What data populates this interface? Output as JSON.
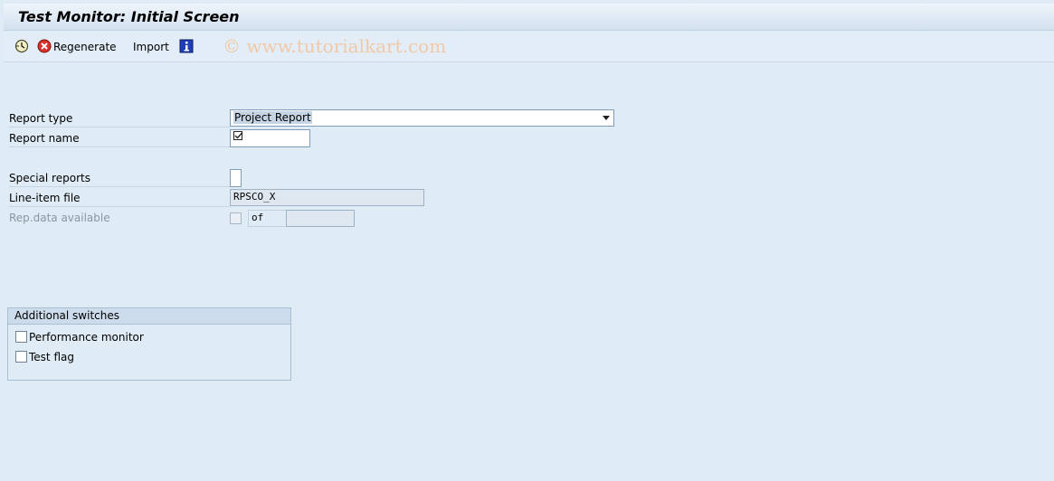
{
  "window": {
    "title": "Test Monitor: Initial Screen"
  },
  "toolbar": {
    "items": [
      {
        "icon": "execute-clock-icon",
        "label": ""
      },
      {
        "icon": "regenerate-icon",
        "label": "Regenerate"
      },
      {
        "icon": "",
        "label": "Import"
      },
      {
        "icon": "info-icon",
        "label": ""
      }
    ],
    "watermark": "© www.tutorialkart.com"
  },
  "form": {
    "report_type": {
      "label": "Report type",
      "value": "Project Report"
    },
    "report_name": {
      "label": "Report name",
      "value": ""
    },
    "special_reports": {
      "label": "Special reports",
      "value": ""
    },
    "line_item_file": {
      "label": "Line-item file",
      "value": "RPSCO_X"
    },
    "rep_data_available": {
      "label": "Rep.data available",
      "of_label": "of",
      "value": ""
    }
  },
  "additional_switches": {
    "title": "Additional switches",
    "options": [
      {
        "label": "Performance monitor",
        "checked": false
      },
      {
        "label": "Test flag",
        "checked": false
      }
    ]
  }
}
